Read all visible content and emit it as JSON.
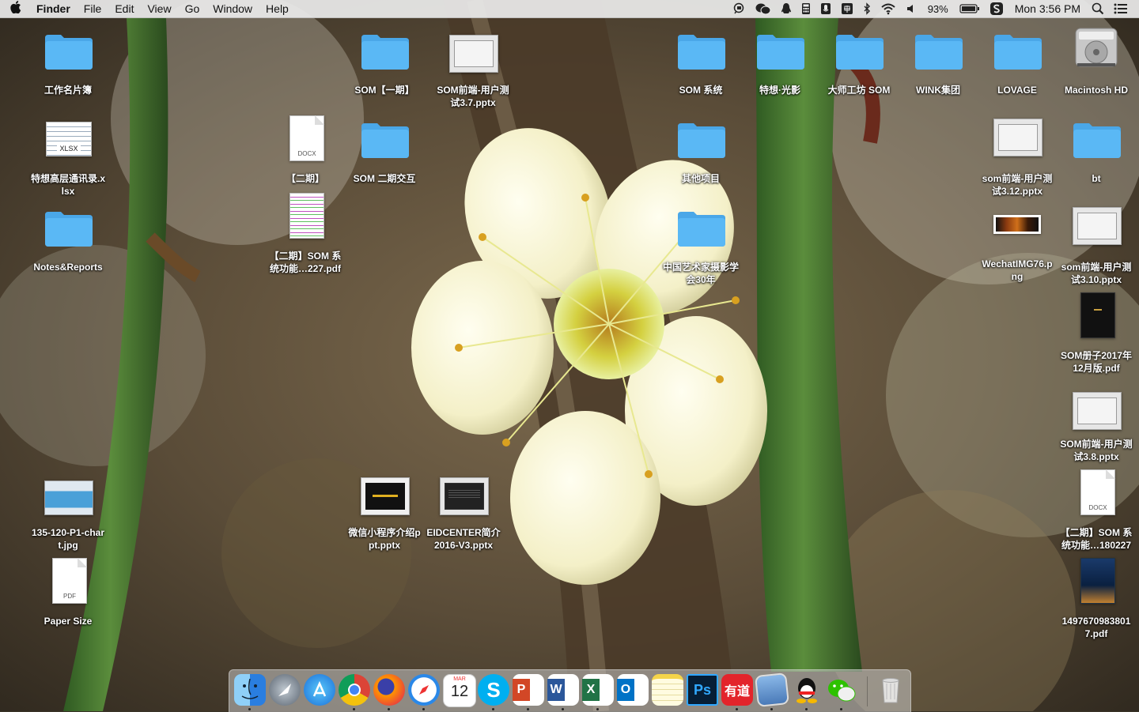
{
  "menubar": {
    "app_name": "Finder",
    "menus": [
      "File",
      "Edit",
      "View",
      "Go",
      "Window",
      "Help"
    ],
    "battery_percent": "93%",
    "clock": "Mon 3:56 PM",
    "status_icons": [
      "screen-capture-icon",
      "wechat-status-icon",
      "qq-status-icon",
      "calculator-icon",
      "microphone-icon",
      "input-method-icon",
      "bluetooth-icon",
      "wifi-icon",
      "volume-icon",
      "battery-icon",
      "sogou-input-icon",
      "spotlight-icon",
      "notification-center-icon"
    ]
  },
  "desktop": {
    "icons": [
      {
        "label": "工作名片簿",
        "type": "folder"
      },
      {
        "label": "特想高层通讯录.xlsx",
        "type": "xlsx"
      },
      {
        "label": "Notes&Reports",
        "type": "folder"
      },
      {
        "label": "135-120-P1-chart.jpg",
        "type": "image"
      },
      {
        "label": "Paper Size",
        "type": "pdf"
      },
      {
        "label": "【二期】",
        "type": "docx"
      },
      {
        "label": "【二期】SOM 系统功能…227.pdf",
        "type": "pdf-chart"
      },
      {
        "label": "SOM【一期】",
        "type": "folder"
      },
      {
        "label": "SOM 二期交互",
        "type": "folder"
      },
      {
        "label": "微信小程序介绍ppt.pptx",
        "type": "pptx-dark"
      },
      {
        "label": "SOM前端-用户测试3.7.pptx",
        "type": "pptx"
      },
      {
        "label": "EIDCENTER简介2016-V3.pptx",
        "type": "pptx-dark2"
      },
      {
        "label": "SOM 系统",
        "type": "folder"
      },
      {
        "label": "其他项目",
        "type": "folder"
      },
      {
        "label": "中国艺术家摄影学会30年",
        "type": "folder"
      },
      {
        "label": "特想·光影",
        "type": "folder"
      },
      {
        "label": "大师工坊 SOM",
        "type": "folder"
      },
      {
        "label": "WINK集团",
        "type": "folder"
      },
      {
        "label": "LOVAGE",
        "type": "folder"
      },
      {
        "label": "som前端-用户测试3.12.pptx",
        "type": "pptx"
      },
      {
        "label": "WechatIMG76.png",
        "type": "png"
      },
      {
        "label": "Macintosh HD",
        "type": "disk"
      },
      {
        "label": "bt",
        "type": "folder"
      },
      {
        "label": "som前端-用户测试3.10.pptx",
        "type": "pptx"
      },
      {
        "label": "SOM册子2017年12月版.pdf",
        "type": "pdf-black"
      },
      {
        "label": "SOM前端-用户测试3.8.pptx",
        "type": "pptx"
      },
      {
        "label": "【二期】SOM 系统功能…180227",
        "type": "docx"
      },
      {
        "label": "14976709838017.pdf",
        "type": "pdf-photo"
      }
    ],
    "doc_tags": {
      "docx": "DOCX",
      "pdf": "PDF",
      "xlsx": "XLSX"
    }
  },
  "dock": {
    "apps": [
      {
        "name": "Finder",
        "icon": "finder-icon",
        "running": true
      },
      {
        "name": "Launchpad",
        "icon": "launchpad-icon",
        "running": false
      },
      {
        "name": "App Store",
        "icon": "app-store-icon",
        "running": false
      },
      {
        "name": "Google Chrome",
        "icon": "chrome-icon",
        "running": true
      },
      {
        "name": "Firefox",
        "icon": "firefox-icon",
        "running": true
      },
      {
        "name": "Safari",
        "icon": "safari-icon",
        "running": true
      },
      {
        "name": "Calendar",
        "icon": "calendar-icon",
        "running": false,
        "month": "MAR",
        "day": "12"
      },
      {
        "name": "Skype",
        "icon": "skype-icon",
        "running": true
      },
      {
        "name": "PowerPoint",
        "icon": "powerpoint-icon",
        "running": true
      },
      {
        "name": "Word",
        "icon": "word-icon",
        "running": true
      },
      {
        "name": "Excel",
        "icon": "excel-icon",
        "running": true
      },
      {
        "name": "Outlook",
        "icon": "outlook-icon",
        "running": false
      },
      {
        "name": "Notes",
        "icon": "notes-icon",
        "running": false
      },
      {
        "name": "Photoshop",
        "icon": "photoshop-icon",
        "running": false,
        "glyph": "Ps"
      },
      {
        "name": "Youdao Dictionary",
        "icon": "youdao-icon",
        "running": true,
        "glyph": "有道"
      },
      {
        "name": "Preview",
        "icon": "preview-icon",
        "running": true
      },
      {
        "name": "QQ",
        "icon": "qq-icon",
        "running": true
      },
      {
        "name": "WeChat",
        "icon": "wechat-icon",
        "running": true
      },
      {
        "name": "Trash",
        "icon": "trash-icon",
        "running": false
      }
    ]
  },
  "colors": {
    "folder": "#5ab8f5",
    "folder_tab": "#4aa7e8",
    "menubar": "#ececec"
  }
}
